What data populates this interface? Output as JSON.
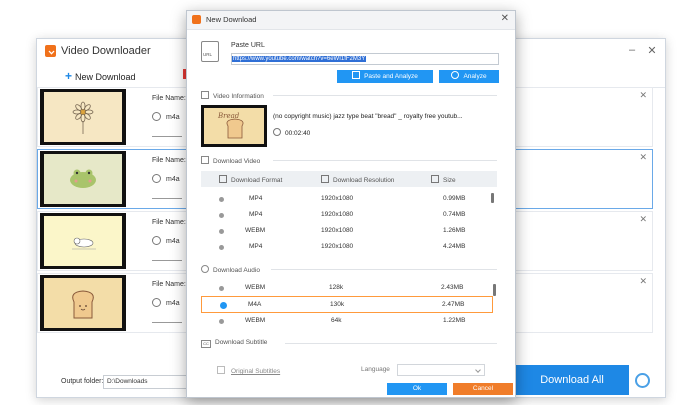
{
  "app": {
    "title": "Video Downloader",
    "new_download": "New Download",
    "file_name_label": "File Name:",
    "rows": [
      {
        "format": "m4a"
      },
      {
        "format": "m4a"
      },
      {
        "format": "m4a"
      },
      {
        "format": "m4a"
      }
    ],
    "output_folder_label": "Output folder:",
    "output_folder_value": "D:\\Downloads",
    "download_all": "Download All"
  },
  "dialog": {
    "title": "New Download",
    "paste_url_label": "Paste URL",
    "url_value": "https://www.youtube.com/watch?v=6eWI1fF2M3Y",
    "url_icon_text": "URL",
    "paste_and_analyze": "Paste and Analyze",
    "analyze": "Analyze",
    "video_info": {
      "section": "Video Information",
      "title": "(no copyright music) jazz type beat \"bread\" _ royalty free youtub...",
      "duration": "00:02:40",
      "thumb_text": "Bread"
    },
    "download_video": {
      "section": "Download Video",
      "headers": [
        "Download Format",
        "Download Resolution",
        "Size"
      ],
      "rows": [
        {
          "format": "MP4",
          "resolution": "1920x1080",
          "size": "0.99MB"
        },
        {
          "format": "MP4",
          "resolution": "1920x1080",
          "size": "0.74MB"
        },
        {
          "format": "WEBM",
          "resolution": "1920x1080",
          "size": "1.26MB"
        },
        {
          "format": "MP4",
          "resolution": "1920x1080",
          "size": "4.24MB"
        }
      ]
    },
    "download_audio": {
      "section": "Download Audio",
      "rows": [
        {
          "format": "WEBM",
          "bitrate": "128k",
          "size": "2.43MB",
          "selected": false
        },
        {
          "format": "M4A",
          "bitrate": "130k",
          "size": "2.47MB",
          "selected": true
        },
        {
          "format": "WEBM",
          "bitrate": "64k",
          "size": "1.22MB",
          "selected": false
        }
      ]
    },
    "download_subtitle": {
      "section": "Download Subtitle",
      "cc_icon_text": "CC",
      "original_subtitles": "Original Subtitles",
      "language_label": "Language"
    },
    "ok": "Ok",
    "cancel": "Cancel"
  },
  "colors": {
    "accent": "#2196f3",
    "brand": "#f0711b",
    "cancel": "#f07d2a",
    "selected_row": "#ff9a3c"
  }
}
